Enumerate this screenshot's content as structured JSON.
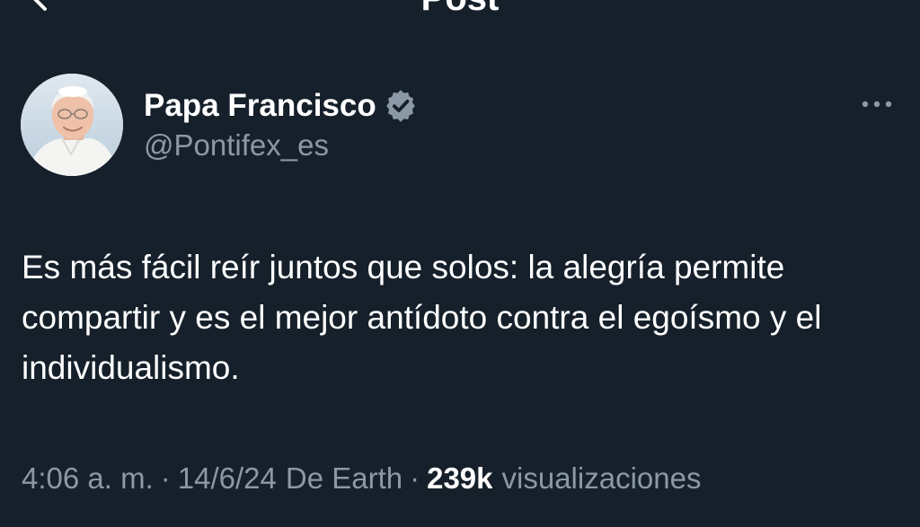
{
  "header": {
    "title": "Post"
  },
  "author": {
    "name": "Papa Francisco",
    "handle": "@Pontifex_es",
    "verified": true
  },
  "post": {
    "text": "Es más fácil reír juntos que solos: la alegría permite compartir y es el mejor antídoto contra el egoísmo y el individualismo."
  },
  "meta": {
    "time": "4:06 a. m.",
    "separator": "·",
    "date": "14/6/24",
    "source": "De Earth",
    "views_count": "239k",
    "views_label": "visualizaciones"
  },
  "icons": {
    "back": "back-arrow-icon",
    "verified": "verified-badge-icon",
    "more": "more-options-icon"
  },
  "colors": {
    "background": "#15202b",
    "text_primary": "#ffffff",
    "text_secondary": "#8b98a5",
    "verified_badge": "#8b98a5"
  }
}
